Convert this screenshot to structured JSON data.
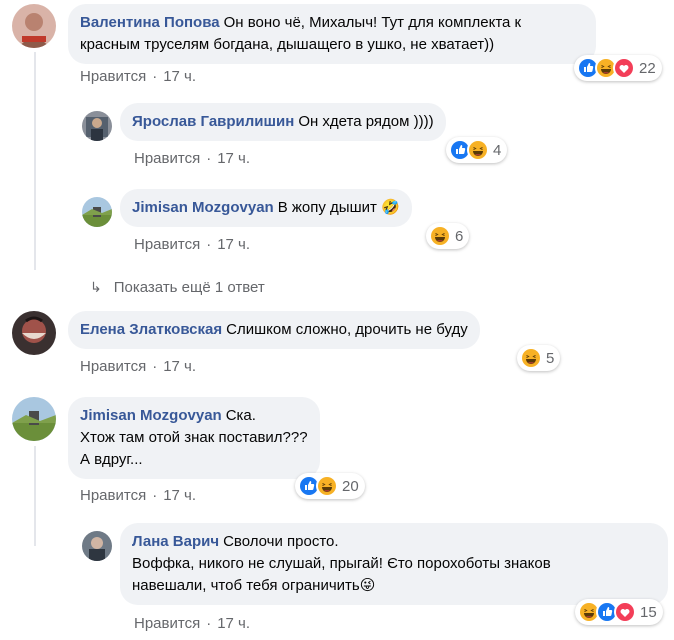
{
  "comments": [
    {
      "author": "Валентина Попова",
      "lines": [
        "Он воно чё, Михалыч! Тут для комплекта к",
        "красным труселям богдана, дышащего в ушко, не хватает))"
      ],
      "like_label": "Нравится",
      "time": "17 ч.",
      "reaction_count": "22",
      "reactions": [
        "like",
        "haha",
        "love"
      ]
    },
    {
      "author": "Ярослав Гаврилишин",
      "lines": [
        "Он хдета рядом ))))"
      ],
      "like_label": "Нравится",
      "time": "17 ч.",
      "reaction_count": "4",
      "reactions": [
        "like",
        "haha"
      ]
    },
    {
      "author": "Jimisan Mozgovyan",
      "lines": [
        "В жопу дышит 🤣"
      ],
      "like_label": "Нравится",
      "time": "17 ч.",
      "reaction_count": "6",
      "reactions": [
        "haha"
      ]
    },
    {
      "author": "Елена Златковская",
      "lines": [
        "Слишком сложно, дрочить не буду"
      ],
      "like_label": "Нравится",
      "time": "17 ч.",
      "reaction_count": "5",
      "reactions": [
        "haha"
      ]
    },
    {
      "author": "Jimisan Mozgovyan",
      "lines": [
        "Ска.",
        "Хтож там отой знак поставил???",
        "А вдруг..."
      ],
      "like_label": "Нравится",
      "time": "17 ч.",
      "reaction_count": "20",
      "reactions": [
        "like",
        "haha"
      ]
    },
    {
      "author": "Лана Варич",
      "lines": [
        "Сволочи просто.",
        "Воффка, никого не слушай, прыгай! Єто порохоботы знаков",
        "навешали, чтоб тебя ограничить😜"
      ],
      "like_label": "Нравится",
      "time": "17 ч.",
      "reaction_count": "15",
      "reactions": [
        "haha",
        "like",
        "love"
      ]
    }
  ],
  "more_replies": {
    "label": "Показать ещё 1 ответ"
  },
  "colors": {
    "author": "#385898",
    "bubble": "#f0f2f5",
    "meta": "#65676b",
    "like_blue": "#1877f2",
    "love_red": "#f33e58",
    "haha_yellow": "#f7b125"
  }
}
